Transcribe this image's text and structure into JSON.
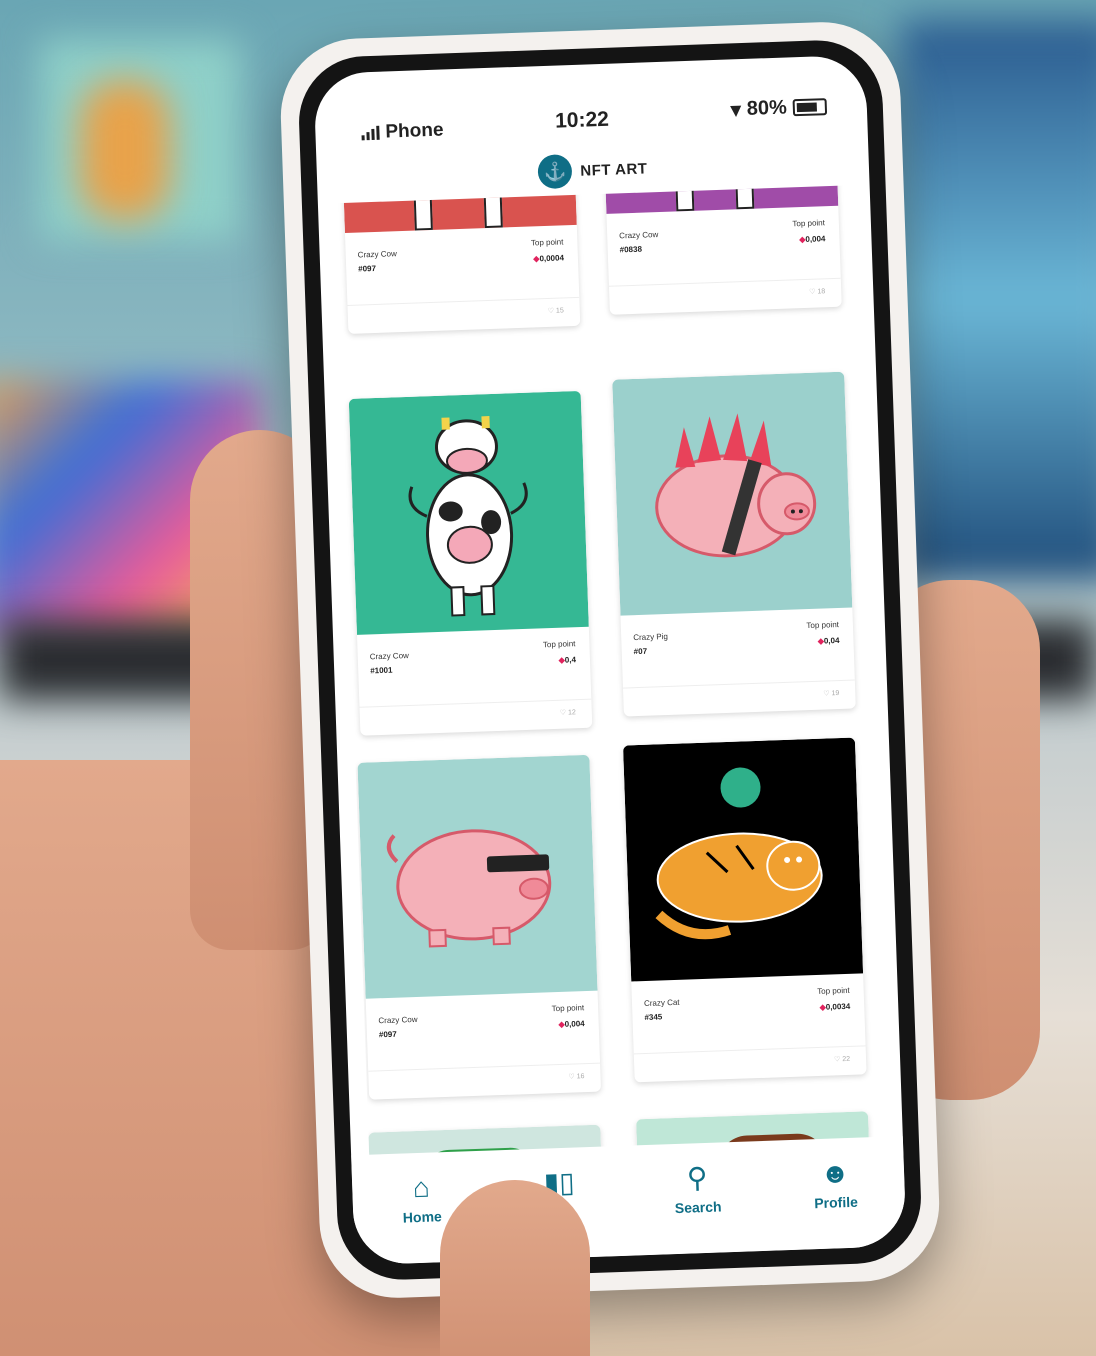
{
  "status_bar": {
    "carrier": "Phone",
    "time": "10:22",
    "battery": "80%"
  },
  "header": {
    "title": "NFT ART"
  },
  "cards": [
    {
      "name": "Crazy Cow",
      "id": "#097",
      "top_label": "Top point",
      "top_value": "0,0004",
      "likes": "15",
      "color": "#d9534f"
    },
    {
      "name": "Crazy Cow",
      "id": "#0838",
      "top_label": "Top point",
      "top_value": "0,004",
      "likes": "18",
      "color": "#a04ca8"
    },
    {
      "name": "Crazy Cow",
      "id": "#1001",
      "top_label": "Top point",
      "top_value": "0,4",
      "likes": "12",
      "color": "#35b894"
    },
    {
      "name": "Crazy Pig",
      "id": "#07",
      "top_label": "Top point",
      "top_value": "0,04",
      "likes": "19",
      "color": "#9bd0cc"
    },
    {
      "name": "Crazy Cow",
      "id": "#097",
      "top_label": "Top point",
      "top_value": "0,004",
      "likes": "16",
      "color": "#a2d5d0"
    },
    {
      "name": "Crazy Cat",
      "id": "#345",
      "top_label": "Top point",
      "top_value": "0,0034",
      "likes": "22",
      "color": "#000000"
    }
  ],
  "bottom_nav": {
    "home": "Home",
    "stats": "",
    "search": "Search",
    "profile": "Profile"
  },
  "colors": {
    "accent": "#0f6e86",
    "price_dot": "#e0245e"
  }
}
